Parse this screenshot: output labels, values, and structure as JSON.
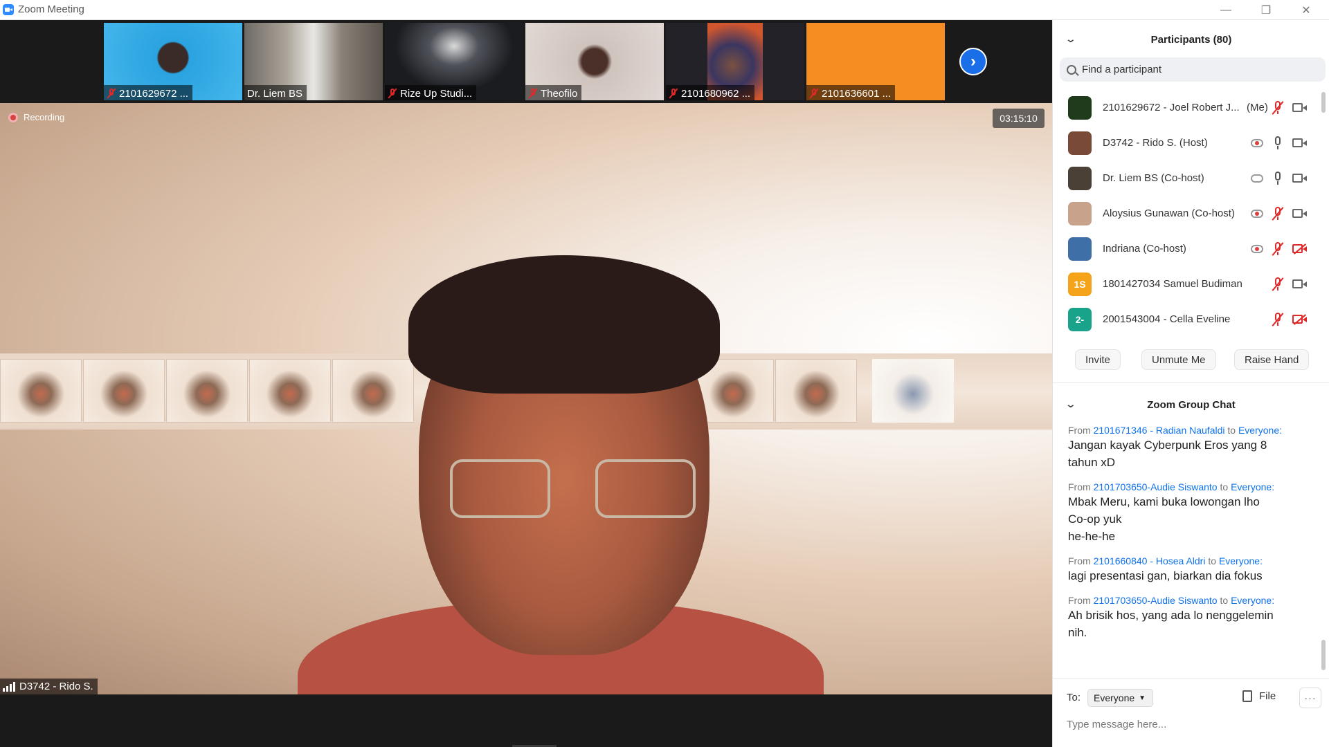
{
  "window": {
    "title": "Zoom Meeting"
  },
  "thumbnails": [
    {
      "label": "2101629672 ...",
      "muted": true,
      "bg": "#2aa3e0"
    },
    {
      "label": "Dr. Liem BS",
      "muted": false,
      "bg": "#8a8278"
    },
    {
      "label": "Rize Up Studi...",
      "muted": true,
      "bg": "#1b1c20"
    },
    {
      "label": "Theofilo",
      "muted": true,
      "bg": "#cfc3bd"
    },
    {
      "label": "2101680962 ...",
      "muted": true,
      "bg": "#222228"
    },
    {
      "label": "2101636601 ...",
      "muted": true,
      "bg": "#f68d22"
    }
  ],
  "main": {
    "recording_label": "Recording",
    "timer": "03:15:10",
    "speaker_label": "D3742 - Rido S."
  },
  "participants": {
    "title": "Participants (80)",
    "search_placeholder": "Find a participant",
    "list": [
      {
        "name": "2101629672 - Joel Robert J...",
        "me": "(Me)",
        "avatar_text": "",
        "avatar_color": "#1f3b1c",
        "cloud": "",
        "mic": "muted",
        "cam": "on"
      },
      {
        "name": "D3742 - Rido S. (Host)",
        "me": "",
        "avatar_text": "",
        "avatar_color": "#7a4a38",
        "cloud": "recording",
        "mic": "on",
        "cam": "on"
      },
      {
        "name": "Dr. Liem BS (Co-host)",
        "me": "",
        "avatar_text": "",
        "avatar_color": "#4a4036",
        "cloud": "idle",
        "mic": "on",
        "cam": "on"
      },
      {
        "name": "Aloysius Gunawan (Co-host)",
        "me": "",
        "avatar_text": "",
        "avatar_color": "#c9a28c",
        "cloud": "recording",
        "mic": "muted",
        "cam": "on"
      },
      {
        "name": "Indriana (Co-host)",
        "me": "",
        "avatar_text": "",
        "avatar_color": "#3e6fa6",
        "cloud": "recording",
        "mic": "muted",
        "cam": "off"
      },
      {
        "name": "1801427034 Samuel Budiman",
        "me": "",
        "avatar_text": "1S",
        "avatar_color": "#f5a31b",
        "cloud": "",
        "mic": "muted",
        "cam": "on"
      },
      {
        "name": "2001543004 - Cella Eveline",
        "me": "",
        "avatar_text": "2-",
        "avatar_color": "#19a38b",
        "cloud": "",
        "mic": "muted",
        "cam": "off"
      }
    ],
    "buttons": {
      "invite": "Invite",
      "unmute": "Unmute Me",
      "raise_hand": "Raise Hand"
    }
  },
  "chat": {
    "title": "Zoom Group Chat",
    "from_word": "From",
    "to_word": "to",
    "messages": [
      {
        "sender": "2101671346 - Radian Naufaldi",
        "recipient": "Everyone:",
        "text": "Jangan kayak Cyberpunk Eros yang 8\ntahun xD"
      },
      {
        "sender": "2101703650-Audie Siswanto",
        "recipient": "Everyone:",
        "text": "Mbak Meru, kami buka lowongan lho\nCo-op yuk\nhe-he-he"
      },
      {
        "sender": "2101660840 - Hosea Aldri",
        "recipient": "Everyone:",
        "text": "lagi presentasi gan, biarkan dia fokus"
      },
      {
        "sender": "2101703650-Audie Siswanto",
        "recipient": "Everyone:",
        "text": "Ah brisik hos, yang ada lo nenggelemin\nnih."
      }
    ],
    "to_label": "To:",
    "recipient_select": "Everyone",
    "file_label": "File",
    "more_label": "···",
    "input_placeholder": "Type message here..."
  },
  "colors": {
    "zoom_blue": "#0e72ed",
    "muted_red": "#e02828",
    "recording_red": "#d94040"
  }
}
